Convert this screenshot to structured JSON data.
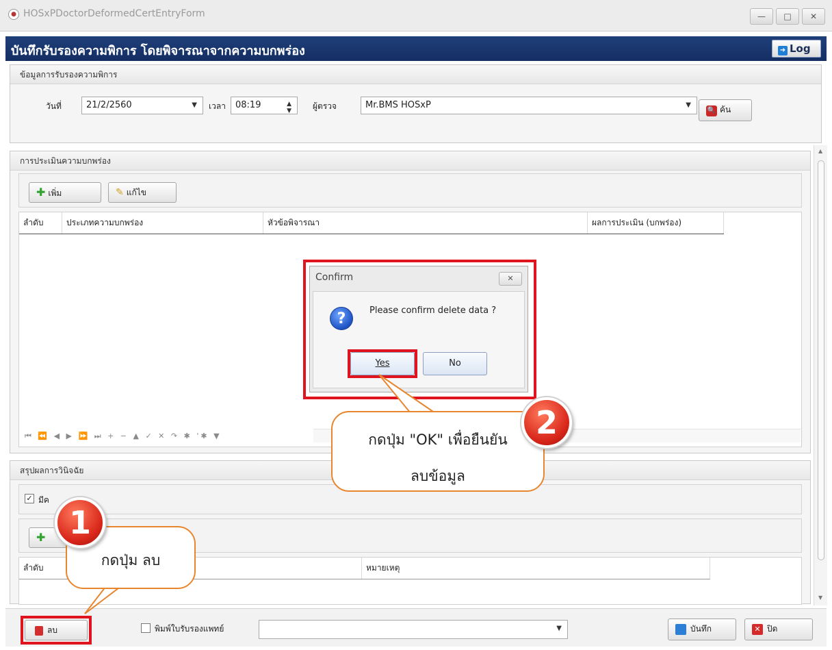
{
  "window": {
    "title": "HOSxPDoctorDeformedCertEntryForm",
    "minimize": "—",
    "maximize": "□",
    "close": "✕"
  },
  "header": {
    "title": "บันทึกรับรองความพิการ โดยพิจารณาจากความบกพร่อง",
    "log_label": "Log"
  },
  "cert_info": {
    "group_label": "ข้อมูลการรับรองความพิการ",
    "date_label": "วันที่",
    "date_value": "21/2/2560",
    "time_label": "เวลา",
    "time_value": "08:19",
    "examiner_label": "ผู้ตรวจ",
    "examiner_value": "Mr.BMS HOSxP",
    "search_label": "ค้น"
  },
  "assessment": {
    "group_label": "การประเมินความบกพร่อง",
    "add_label": "เพิ่ม",
    "edit_label": "แก้ไข",
    "columns": [
      "ลำดับ",
      "ประเภทความบกพร่อง",
      "หัวข้อพิจารณา",
      "ผลการประเมิน (บกพร่อง)"
    ],
    "navigator": "⏮ ⏪ ◀ ▶ ⏩ ⏭ + − ▲ ✓ ✕ ↷ ✱ '✱ ▼"
  },
  "summary": {
    "group_label": "สรุปผลการวินิจฉัย",
    "check_label": "มีค",
    "columns": [
      "ลำดับ",
      "หมายเหตุ"
    ]
  },
  "footer": {
    "delete_label": "ลบ",
    "print_label": "พิมพ์ใบรับรองแพทย์",
    "save_label": "บันทึก",
    "close_label": "ปิด"
  },
  "dialog": {
    "title": "Confirm",
    "close": "✕",
    "message": "Please confirm delete data ?",
    "yes_label": "Yes",
    "no_label": "No"
  },
  "callouts": {
    "step1_number": "1",
    "step1_text": "กดปุ่ม ลบ",
    "step2_number": "2",
    "step2_line1": "กดปุ่ม \"OK\" เพื่อยืนยัน",
    "step2_line2": "ลบข้อมูล"
  },
  "colors": {
    "header_bg": "#142e62",
    "highlight": "#e0141e",
    "callout_border": "#e7862e"
  }
}
